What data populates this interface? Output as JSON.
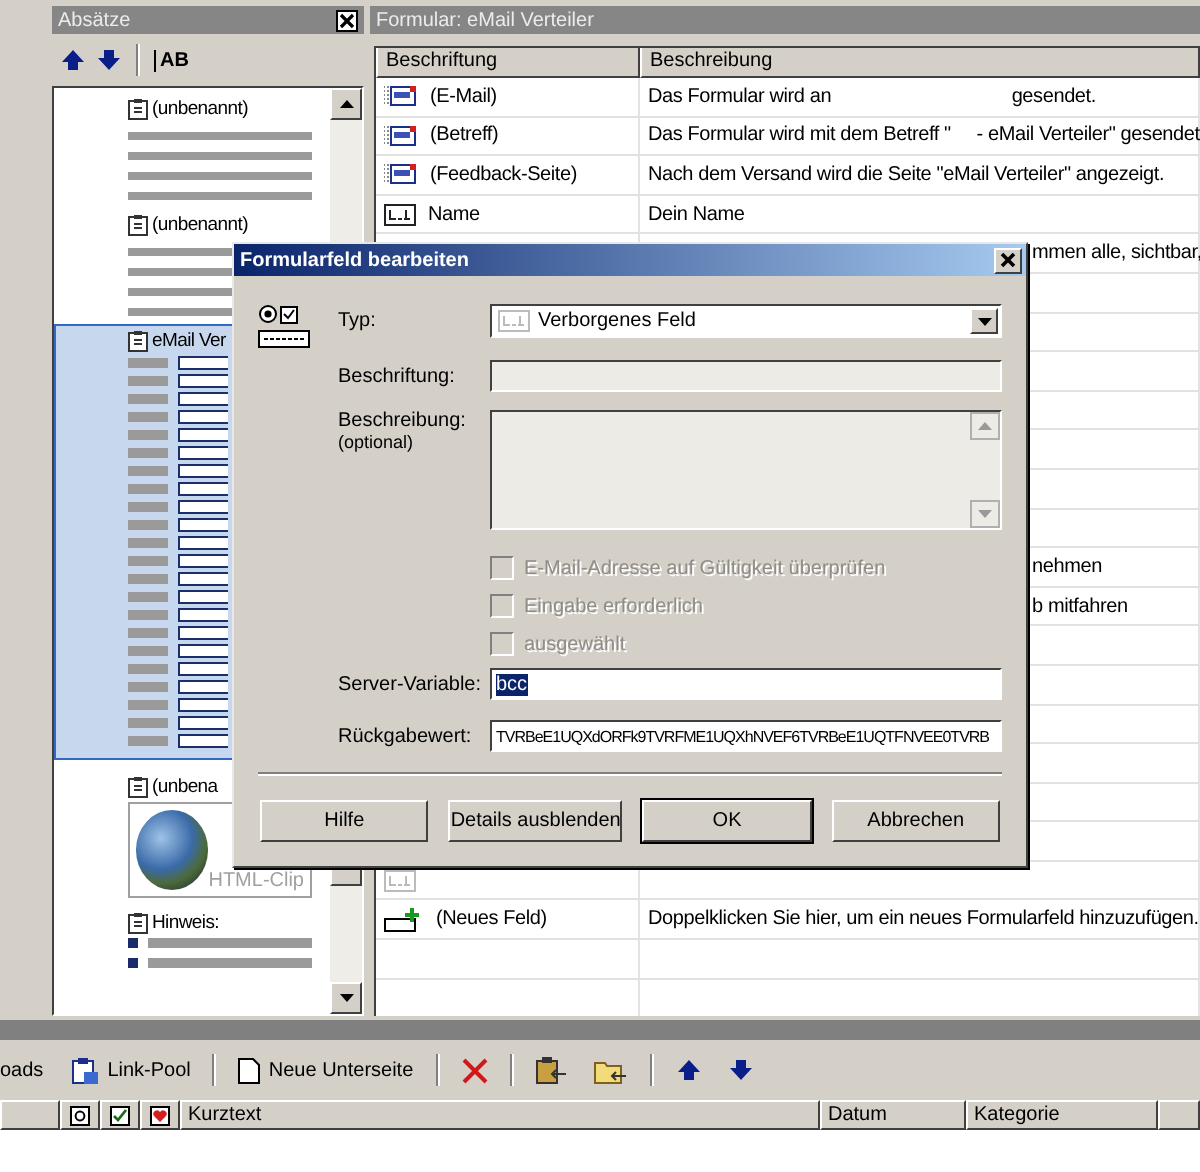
{
  "left_panel": {
    "title": "Absätze",
    "toolbar_text": "AB",
    "items": [
      {
        "kind": "text",
        "label": "(unbenannt)",
        "selected": false
      },
      {
        "kind": "text",
        "label": "(unbenannt)",
        "selected": false
      },
      {
        "kind": "form",
        "label": "eMail Ver",
        "selected": true
      },
      {
        "kind": "clip",
        "label": "(unbena",
        "caption": "HTML-Clip",
        "selected": false
      },
      {
        "kind": "list",
        "label": "Hinweis:",
        "selected": false
      }
    ]
  },
  "form_panel": {
    "title": "Formular: eMail Verteiler",
    "columns": [
      "Beschriftung",
      "Beschreibung"
    ],
    "rows": [
      {
        "kind": "mail",
        "label": "(E-Mail)",
        "description": "Das Formular wird an                                   gesendet."
      },
      {
        "kind": "mail",
        "label": "(Betreff)",
        "description": "Das Formular wird mit dem Betreff \"     - eMail Verteiler\" gesendet"
      },
      {
        "kind": "mail",
        "label": "(Feedback-Seite)",
        "description": "Nach dem Versand wird die Seite \"eMail Verteiler\" angezeigt."
      },
      {
        "kind": "text",
        "label": "Name",
        "description": "Dein Name"
      },
      {
        "kind": "covered",
        "description": "mmen alle, sichtbar,"
      },
      {
        "kind": "blank"
      },
      {
        "kind": "blank"
      },
      {
        "kind": "blank"
      },
      {
        "kind": "blank"
      },
      {
        "kind": "blank"
      },
      {
        "kind": "blank"
      },
      {
        "kind": "blank"
      },
      {
        "kind": "covered",
        "description": "nehmen"
      },
      {
        "kind": "covered",
        "description": "b mitfahren"
      },
      {
        "kind": "blank"
      },
      {
        "kind": "blank"
      },
      {
        "kind": "blank"
      },
      {
        "kind": "blank"
      },
      {
        "kind": "blank"
      },
      {
        "kind": "blank"
      },
      {
        "kind": "hidden"
      },
      {
        "kind": "new",
        "label": "(Neues Feld)",
        "description": "Doppelklicken Sie hier, um ein neues Formularfeld hinzuzufügen."
      },
      {
        "kind": "blank"
      },
      {
        "kind": "blank"
      }
    ]
  },
  "dialog": {
    "title": "Formularfeld bearbeiten",
    "type": {
      "label": "Typ:",
      "value": "Verborgenes Feld"
    },
    "caption": {
      "label": "Beschriftung:",
      "disabled": true
    },
    "description": {
      "label": "Beschreibung:",
      "hint": "(optional)",
      "disabled": true
    },
    "checkboxes": [
      {
        "label": "E-Mail-Adresse auf Gültigkeit überprüfen",
        "checked": false,
        "disabled": true
      },
      {
        "label": "Eingabe erforderlich",
        "checked": false,
        "disabled": true
      },
      {
        "label": "ausgewählt",
        "checked": false,
        "disabled": true
      }
    ],
    "server_variable": {
      "label": "Server-Variable:",
      "value": "bcc",
      "selected": true
    },
    "return_value": {
      "label": "Rückgabewert:",
      "value": "TVRBeE1UQXdORFk9TVRFME1UQXhNVEF6TVRBeE1UQTFNVEE0TVRB"
    },
    "buttons": [
      {
        "label": "Hilfe",
        "default": false
      },
      {
        "label": "Details ausblenden",
        "default": false
      },
      {
        "label": "OK",
        "default": true
      },
      {
        "label": "Abbrechen",
        "default": false
      }
    ]
  },
  "toolbar": [
    {
      "kind": "text",
      "label": "oads"
    },
    {
      "kind": "link-pool",
      "label": "Link-Pool"
    },
    {
      "kind": "separator"
    },
    {
      "kind": "new-page",
      "label": "Neue Unterseite"
    },
    {
      "kind": "separator"
    },
    {
      "kind": "delete"
    },
    {
      "kind": "separator"
    },
    {
      "kind": "paste"
    },
    {
      "kind": "paste-folder"
    },
    {
      "kind": "separator"
    },
    {
      "kind": "up"
    },
    {
      "kind": "down"
    }
  ],
  "list_header": [
    {
      "kind": "blank"
    },
    {
      "kind": "note"
    },
    {
      "kind": "check"
    },
    {
      "kind": "heart"
    },
    {
      "kind": "text",
      "label": "Kurztext"
    },
    {
      "kind": "text",
      "label": "Datum"
    },
    {
      "kind": "text",
      "label": "Kategorie"
    },
    {
      "kind": "blank"
    }
  ]
}
